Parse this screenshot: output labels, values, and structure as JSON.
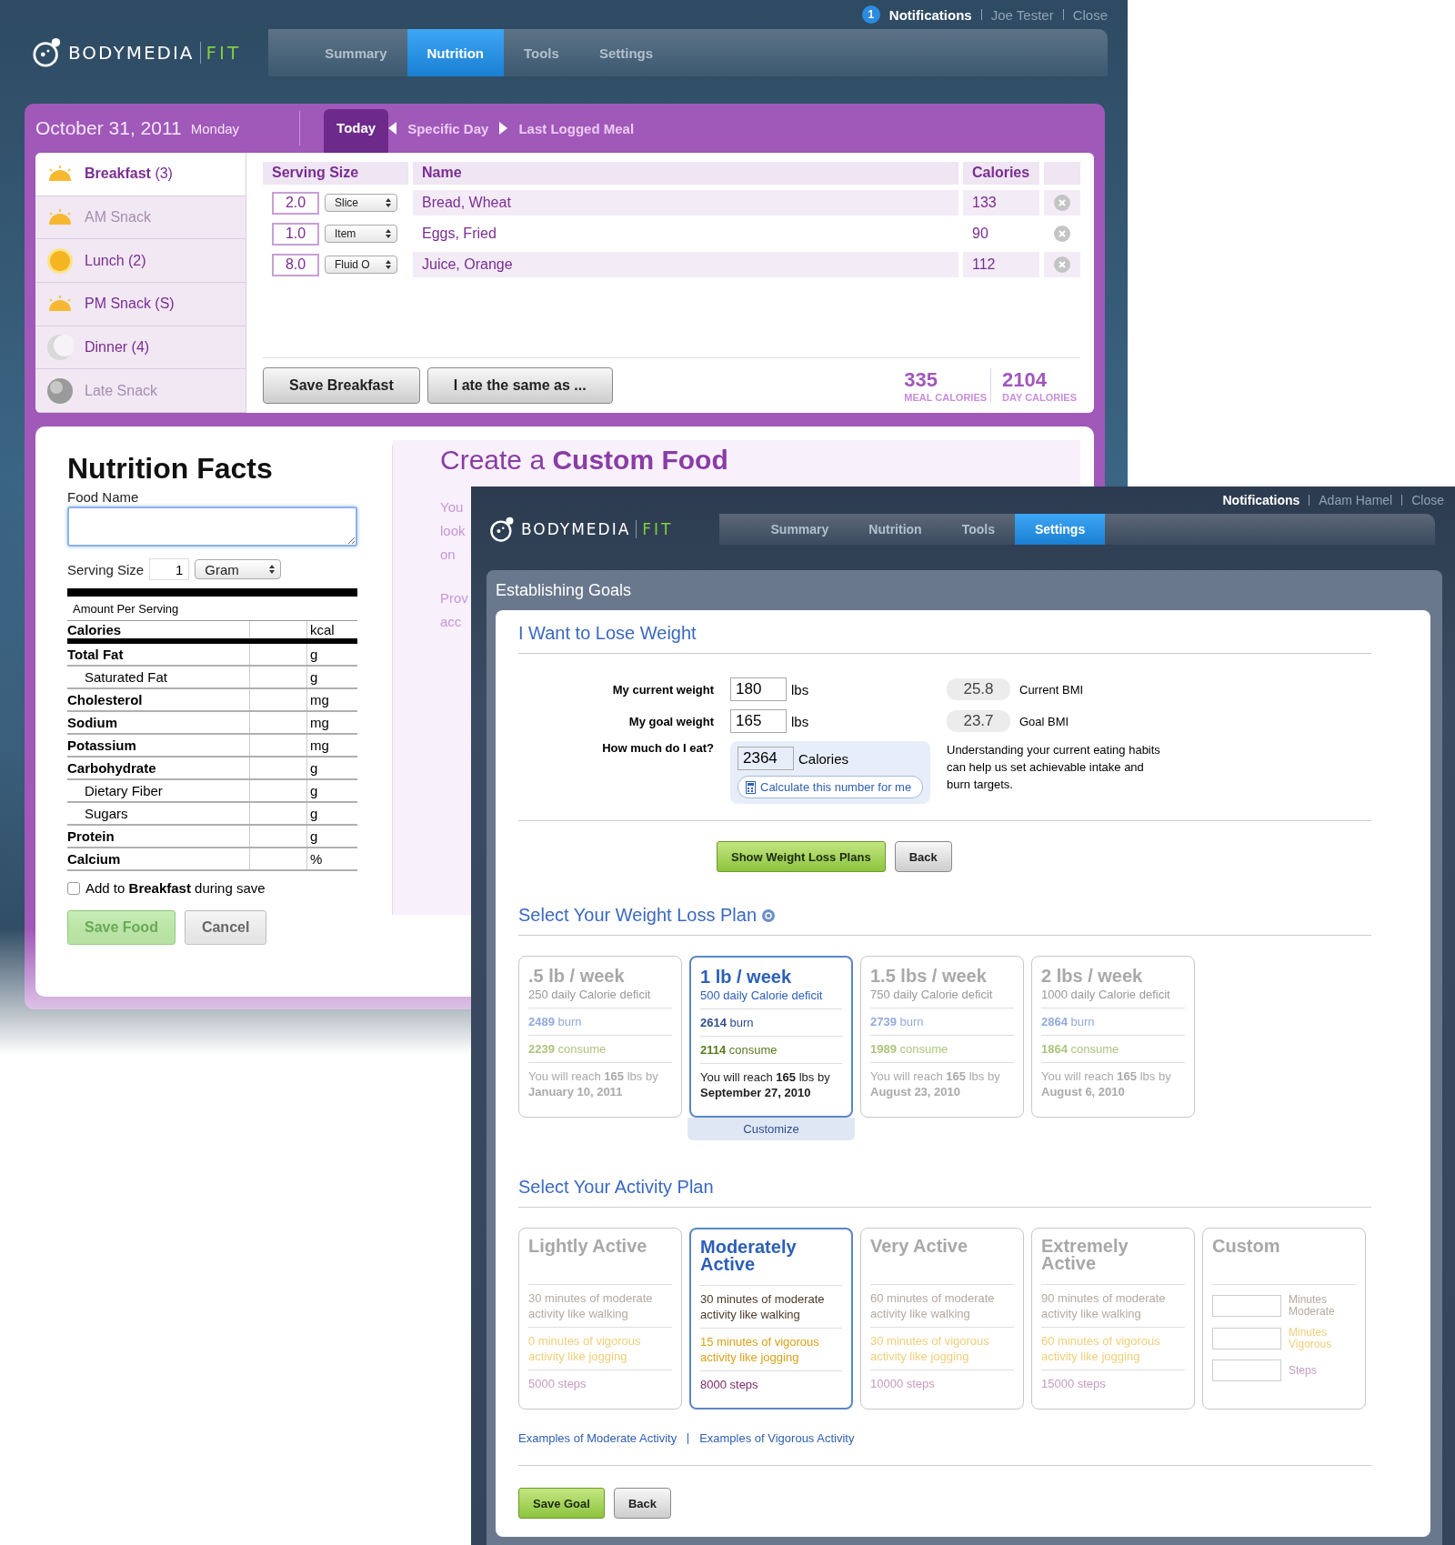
{
  "back_window": {
    "top_links": {
      "notification_count": "1",
      "notifications": "Notifications",
      "user": "Joe Tester",
      "close": "Close"
    },
    "logo": {
      "brand": "BODYMEDIA",
      "product": "FIT"
    },
    "tabs": [
      {
        "label": "Summary",
        "selected": false
      },
      {
        "label": "Nutrition",
        "selected": true
      },
      {
        "label": "Tools",
        "selected": false
      },
      {
        "label": "Settings",
        "selected": false
      }
    ],
    "date_bar": {
      "date": "October 31, 2011",
      "weekday": "Monday",
      "nav": [
        {
          "label": "Today",
          "selected": true
        },
        {
          "label": "Specific Day",
          "selected": false
        },
        {
          "label": "Last Logged Meal",
          "selected": false
        }
      ]
    },
    "meals": [
      {
        "label": "Breakfast",
        "count": "(3)",
        "kind": "sunrise",
        "selected": true,
        "disabled": false
      },
      {
        "label": "AM Snack",
        "kind": "sunrise",
        "selected": false,
        "disabled": true
      },
      {
        "label": "Lunch",
        "count": "(2)",
        "kind": "sun",
        "selected": false,
        "disabled": false
      },
      {
        "label": "PM Snack",
        "count": "(S)",
        "kind": "sunrise",
        "selected": false,
        "disabled": false
      },
      {
        "label": "Dinner",
        "count": "(4)",
        "kind": "moon",
        "selected": false,
        "disabled": false
      },
      {
        "label": "Late Snack",
        "kind": "night",
        "selected": false,
        "disabled": true
      }
    ],
    "food_table": {
      "columns": [
        "Serving Size",
        "Name",
        "Calories"
      ],
      "rows": [
        {
          "amount": "2.0",
          "unit": "Slice",
          "name": "Bread, Wheat",
          "calories": "133"
        },
        {
          "amount": "1.0",
          "unit": "Item",
          "name": "Eggs, Fried",
          "calories": "90"
        },
        {
          "amount": "8.0",
          "unit": "Fluid O",
          "name": "Juice, Orange",
          "calories": "112"
        }
      ]
    },
    "meal_buttons": [
      "Save Breakfast",
      "I ate the same as ..."
    ],
    "totals": [
      {
        "value": "335",
        "label": "MEAL CALORIES"
      },
      {
        "value": "2104",
        "label": "DAY CALORIES"
      }
    ],
    "nutrition_facts": {
      "title": "Nutrition Facts",
      "food_name_label": "Food Name",
      "serving_size": {
        "label": "Serving Size",
        "value": "1",
        "unit": "Gram"
      },
      "amount_label": "Amount Per Serving",
      "nutrients": [
        {
          "name": "Calories",
          "unit": "kcal",
          "kind": "calories"
        },
        {
          "name": "Total Fat",
          "unit": "g",
          "kind": "major"
        },
        {
          "name": "Saturated Fat",
          "unit": "g",
          "kind": "minor"
        },
        {
          "name": "Cholesterol",
          "unit": "mg",
          "kind": "major"
        },
        {
          "name": "Sodium",
          "unit": "mg",
          "kind": "major"
        },
        {
          "name": "Potassium",
          "unit": "mg",
          "kind": "major"
        },
        {
          "name": "Carbohydrate",
          "unit": "g",
          "kind": "major"
        },
        {
          "name": "Dietary Fiber",
          "unit": "g",
          "kind": "minor"
        },
        {
          "name": "Sugars",
          "unit": "g",
          "kind": "minor"
        },
        {
          "name": "Protein",
          "unit": "g",
          "kind": "major"
        },
        {
          "name": "Calcium",
          "unit": "%",
          "kind": "major"
        }
      ],
      "add_to": {
        "text": "Add to **Breakfast** during save",
        "checked": false
      },
      "buttons": [
        {
          "label": "Save Food",
          "kind": "primary"
        },
        {
          "label": "Cancel",
          "kind": "secondary"
        }
      ]
    },
    "custom_food": {
      "title": "Create a **Custom Food**",
      "paragraphs": [
        [
          "You",
          "look",
          "on"
        ],
        [
          "Prov",
          "acc"
        ]
      ]
    }
  },
  "front_window": {
    "top_links": {
      "notifications": "Notifications",
      "user": "Adam Hamel",
      "close": "Close"
    },
    "logo": {
      "brand": "BODYMEDIA",
      "product": "FIT"
    },
    "tabs": [
      {
        "label": "Summary",
        "selected": false
      },
      {
        "label": "Nutrition",
        "selected": false
      },
      {
        "label": "Tools",
        "selected": false
      },
      {
        "label": "Settings",
        "selected": true
      }
    ],
    "panel_title": "Establishing Goals",
    "lose_weight": {
      "title": "I Want to Lose Weight",
      "fields": [
        {
          "label": "My current weight",
          "value": "180",
          "unit": "lbs"
        },
        {
          "label": "My goal weight",
          "value": "165",
          "unit": "lbs"
        },
        {
          "label": "How much do I eat?",
          "value": "2364",
          "unit": "Calories"
        }
      ],
      "calculate_button": "Calculate this number for me",
      "bmi": [
        {
          "value": "25.8",
          "label": "Current BMI"
        },
        {
          "value": "23.7",
          "label": "Goal BMI"
        }
      ],
      "note": "Understanding your current eating habits can help us set achievable intake and burn targets.",
      "buttons": [
        {
          "label": "Show Weight Loss Plans",
          "kind": "primary"
        },
        {
          "label": "Back",
          "kind": "secondary"
        }
      ]
    },
    "weight_plans": {
      "title": "Select Your Weight Loss Plan",
      "customize": "Customize",
      "plans": [
        {
          "rate": ".5 lb / week",
          "deficit": "250 daily Calorie deficit",
          "burn": "**2489** burn",
          "consume": "**2239** consume",
          "reach": "You will reach **165** lbs by **January 10, 2011**",
          "selected": false
        },
        {
          "rate": "1 lb / week",
          "deficit": "500 daily Calorie deficit",
          "burn": "**2614** burn",
          "consume": "**2114** consume",
          "reach": "You will reach **165** lbs by **September 27, 2010**",
          "selected": true
        },
        {
          "rate": "1.5 lbs / week",
          "deficit": "750 daily Calorie deficit",
          "burn": "**2739** burn",
          "consume": "**1989** consume",
          "reach": "You will reach **165** lbs by **August 23, 2010**",
          "selected": false
        },
        {
          "rate": "2 lbs / week",
          "deficit": "1000 daily Calorie deficit",
          "burn": "**2864** burn",
          "consume": "**1864** consume",
          "reach": "You will reach **165** lbs by **August 6, 2010**",
          "selected": false
        }
      ]
    },
    "activity_plans": {
      "title": "Select Your Activity Plan",
      "plans": [
        {
          "kind": "preset",
          "name": "Lightly Active",
          "moderate": "30 minutes of moderate activity like walking",
          "vigorous": "0 minutes of vigorous activity like jogging",
          "steps": "5000 steps",
          "selected": false
        },
        {
          "kind": "preset",
          "name": "Moderately Active",
          "moderate": "30 minutes of moderate activity like walking",
          "vigorous": "15 minutes of vigorous activity like jogging",
          "steps": "8000 steps",
          "selected": true
        },
        {
          "kind": "preset",
          "name": "Very Active",
          "moderate": "60 minutes of moderate activity like walking",
          "vigorous": "30 minutes of vigorous activity like jogging",
          "steps": "10000 steps",
          "selected": false
        },
        {
          "kind": "preset",
          "name": "Extremely Active",
          "moderate": "90 minutes of moderate activity like walking",
          "vigorous": "60 minutes of vigorous activity like jogging",
          "steps": "15000 steps",
          "selected": false
        },
        {
          "kind": "custom",
          "name": "Custom",
          "fields": [
            {
              "label": "Minutes Moderate",
              "kind": "moderate"
            },
            {
              "label": "Minutes Vigorous",
              "kind": "vigorous"
            },
            {
              "label": "Steps",
              "kind": "steps"
            }
          ],
          "selected": false
        }
      ],
      "links": [
        "Examples of Moderate Activity",
        "Examples of Vigorous Activity"
      ],
      "buttons": [
        {
          "label": "Save Goal",
          "kind": "primary"
        },
        {
          "label": "Back",
          "kind": "secondary"
        }
      ]
    }
  }
}
